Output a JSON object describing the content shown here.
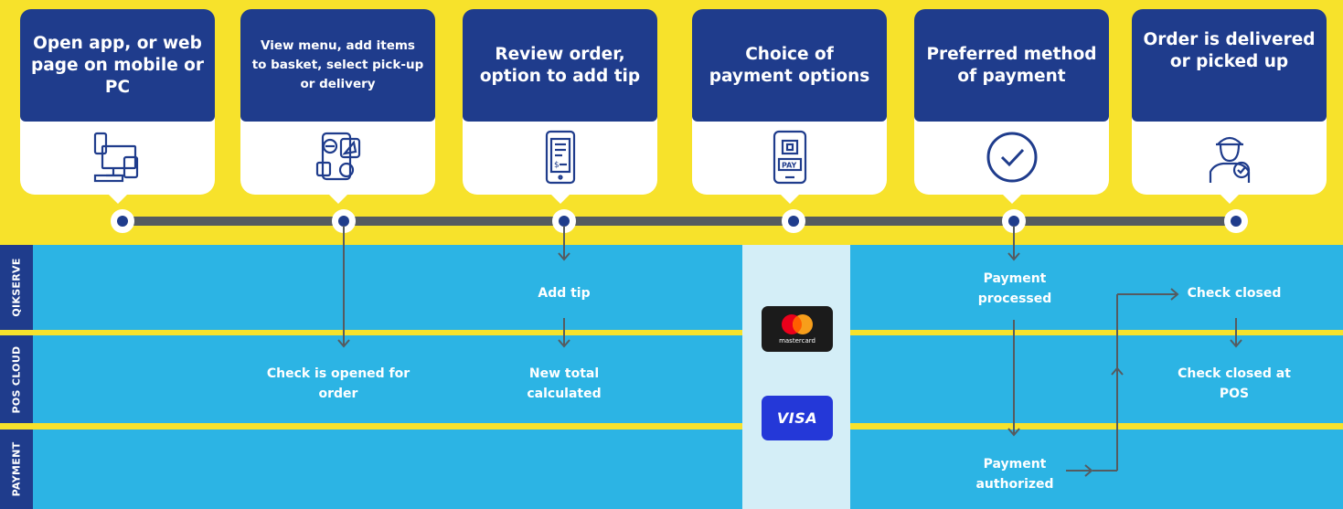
{
  "steps": [
    {
      "title": "Open app, or web page on mobile or PC",
      "icon": "devices-icon"
    },
    {
      "title": "View menu, add items to basket, select pick-up or delivery",
      "icon": "menu-basket-icon"
    },
    {
      "title": "Review order, option to add tip",
      "icon": "receipt-phone-icon"
    },
    {
      "title": "Choice of payment options",
      "icon": "phone-pay-icon"
    },
    {
      "title": "Preferred method of payment",
      "icon": "checkmark-circle-icon"
    },
    {
      "title": "Order is delivered or picked up",
      "icon": "courier-icon"
    }
  ],
  "lanes": {
    "qikserve": "QIKSERVE",
    "pos_cloud": "POS CLOUD",
    "payment": "PAYMENT"
  },
  "flow": {
    "add_tip": "Add tip",
    "new_total": "New total calculated",
    "check_opened": "Check is opened for order",
    "payment_processed": "Payment processed",
    "payment_authorized": "Payment authorized",
    "check_closed": "Check closed",
    "check_closed_pos": "Check closed at POS"
  },
  "payment_logos": {
    "mastercard": "mastercard",
    "visa": "VISA"
  },
  "colors": {
    "background": "#f7e22b",
    "navy": "#1f3c8c",
    "lane": "#2cb4e4",
    "timeline": "#555b60",
    "payband": "#d4eef7"
  }
}
